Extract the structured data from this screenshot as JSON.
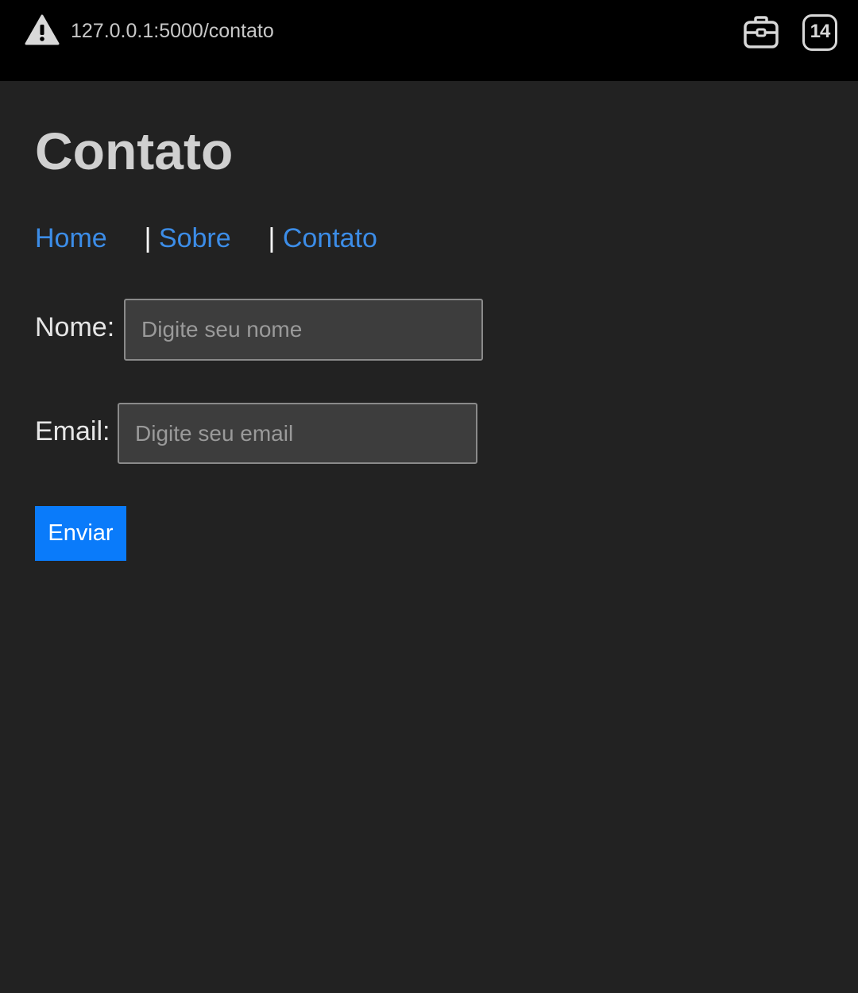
{
  "browser": {
    "url": "127.0.0.1:5000/contato",
    "tab_count": "14",
    "icons": [
      "warning-icon",
      "toolbox-icon",
      "tabs-counter-icon"
    ]
  },
  "page": {
    "title": "Contato",
    "nav": [
      {
        "label": "Home"
      },
      {
        "label": "Sobre"
      },
      {
        "label": "Contato"
      }
    ],
    "nav_separator": "|"
  },
  "form": {
    "name_label": "Nome:",
    "name_placeholder": "Digite seu nome",
    "name_value": "",
    "email_label": "Email:",
    "email_placeholder": "Digite seu email",
    "email_value": "",
    "submit_label": "Enviar"
  },
  "colors": {
    "background": "#222222",
    "link": "#3c8de8",
    "button": "#0a7bfa"
  }
}
